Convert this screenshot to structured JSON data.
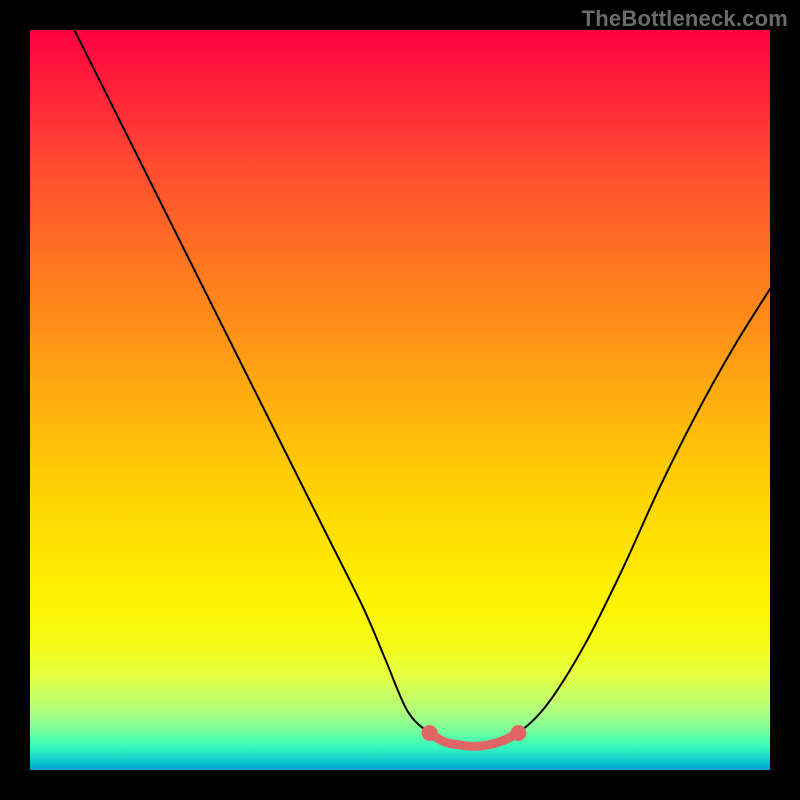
{
  "watermark": "TheBottleneck.com",
  "colors": {
    "frame_bg": "#000000",
    "curve": "#000000",
    "highlight": "#e06666",
    "watermark": "#6b6b6b"
  },
  "chart_data": {
    "type": "line",
    "title": "",
    "xlabel": "",
    "ylabel": "",
    "xlim": [
      0,
      100
    ],
    "ylim": [
      0,
      100
    ],
    "grid": false,
    "legend": false,
    "series": [
      {
        "name": "bottleneck-curve",
        "x": [
          6,
          10,
          15,
          20,
          25,
          30,
          35,
          40,
          45,
          48,
          51,
          54,
          57,
          60,
          63,
          66,
          70,
          75,
          80,
          85,
          90,
          95,
          100
        ],
        "y": [
          100,
          92,
          82,
          72,
          62,
          52,
          42,
          32,
          22,
          15,
          8,
          5,
          3.5,
          3.2,
          3.5,
          5,
          9,
          17,
          27,
          38,
          48,
          57,
          65
        ]
      }
    ],
    "highlight": {
      "name": "optimal-range",
      "x_start": 54,
      "x_end": 66,
      "y_start": 5,
      "y_end": 5,
      "points": [
        {
          "x": 54,
          "y": 5.0
        },
        {
          "x": 56,
          "y": 3.8
        },
        {
          "x": 58,
          "y": 3.4
        },
        {
          "x": 60,
          "y": 3.2
        },
        {
          "x": 62,
          "y": 3.4
        },
        {
          "x": 64,
          "y": 4.0
        },
        {
          "x": 66,
          "y": 5.0
        }
      ]
    }
  }
}
